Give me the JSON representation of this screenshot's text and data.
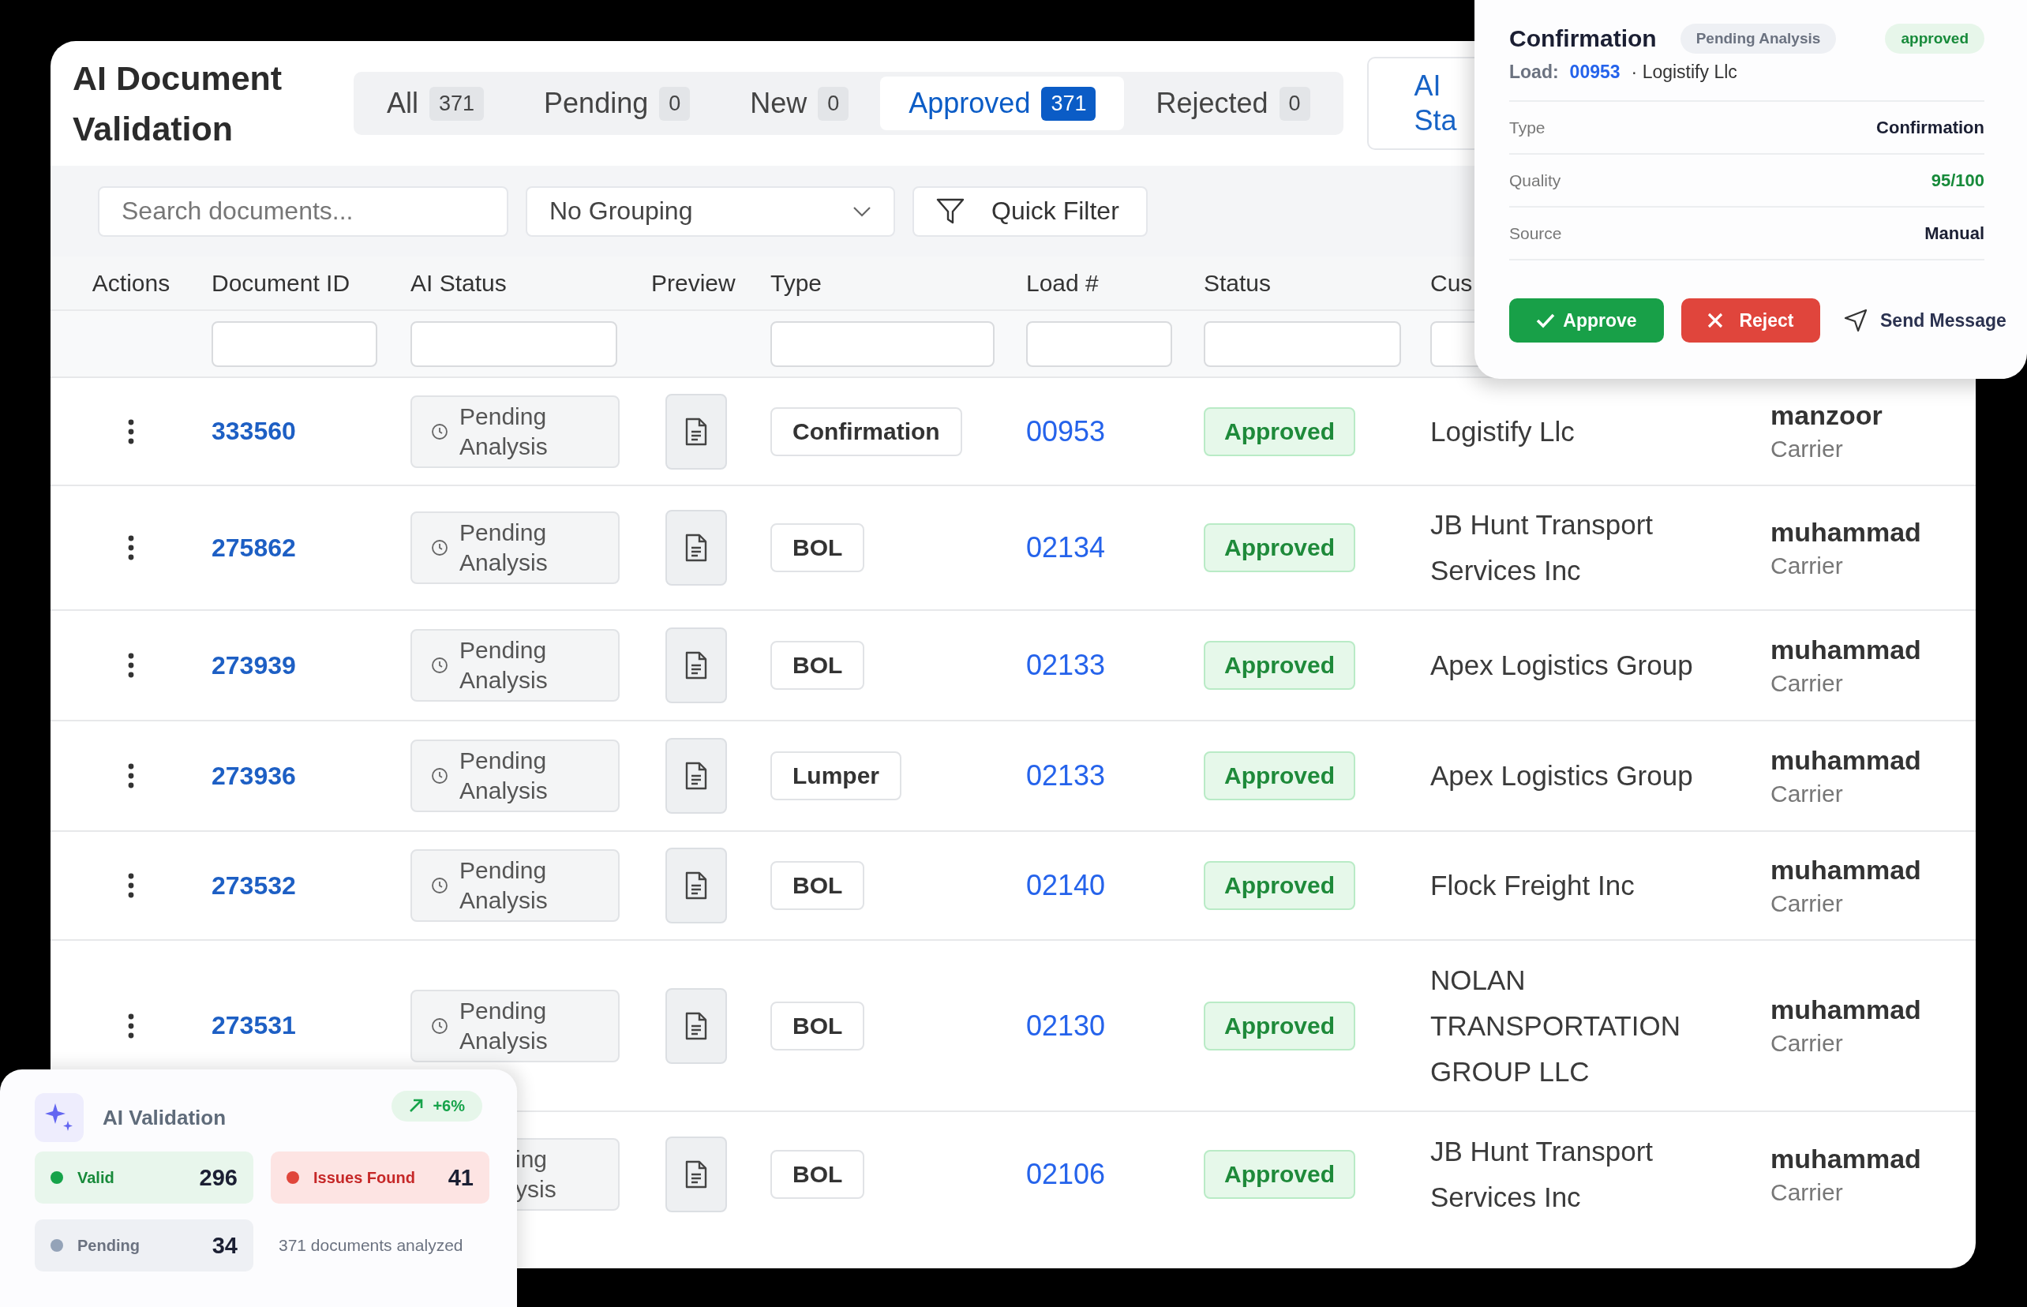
{
  "header": {
    "title": "AI Document Validation"
  },
  "tabs": [
    {
      "label": "All",
      "count": "371",
      "selected": false
    },
    {
      "label": "Pending",
      "count": "0",
      "selected": false
    },
    {
      "label": "New",
      "count": "0",
      "selected": false
    },
    {
      "label": "Approved",
      "count": "371",
      "selected": true
    },
    {
      "label": "Rejected",
      "count": "0",
      "selected": false
    }
  ],
  "side_button": {
    "label": "AI Sta"
  },
  "toolbar": {
    "search": {
      "placeholder": "Search documents..."
    },
    "grouping": {
      "value": "No Grouping"
    },
    "quick_filter": {
      "label": "Quick Filter"
    }
  },
  "table": {
    "columns": [
      {
        "label": "Actions",
        "filterable": false
      },
      {
        "label": "Document ID",
        "filterable": true
      },
      {
        "label": "AI Status",
        "filterable": true
      },
      {
        "label": "Preview",
        "filterable": false
      },
      {
        "label": "Type",
        "filterable": true
      },
      {
        "label": "Load #",
        "filterable": true
      },
      {
        "label": "Status",
        "filterable": true
      },
      {
        "label": "Cus",
        "filterable": true
      }
    ],
    "rows": [
      {
        "document_id": "333560",
        "ai_status": "Pending Analysis",
        "type": "Confirmation",
        "load": "00953",
        "status": "Approved",
        "customer": "Logistify Llc",
        "user": "manzoor",
        "role": "Carrier"
      },
      {
        "document_id": "275862",
        "ai_status": "Pending Analysis",
        "type": "BOL",
        "load": "02134",
        "status": "Approved",
        "customer": "JB Hunt Transport Services Inc",
        "user": "muhammad",
        "role": "Carrier"
      },
      {
        "document_id": "273939",
        "ai_status": "Pending Analysis",
        "type": "BOL",
        "load": "02133",
        "status": "Approved",
        "customer": "Apex Logistics Group",
        "user": "muhammad",
        "role": "Carrier"
      },
      {
        "document_id": "273936",
        "ai_status": "Pending Analysis",
        "type": "Lumper",
        "load": "02133",
        "status": "Approved",
        "customer": "Apex Logistics Group",
        "user": "muhammad",
        "role": "Carrier"
      },
      {
        "document_id": "273532",
        "ai_status": "Pending Analysis",
        "type": "BOL",
        "load": "02140",
        "status": "Approved",
        "customer": "Flock Freight Inc",
        "user": "muhammad",
        "role": "Carrier"
      },
      {
        "document_id": "273531",
        "ai_status": "Pending Analysis",
        "type": "BOL",
        "load": "02130",
        "status": "Approved",
        "customer": "NOLAN TRANSPORTATION GROUP LLC",
        "user": "muhammad",
        "role": "Carrier"
      },
      {
        "ai_status": "ing ysis",
        "ai_status_partial": true,
        "type": "BOL",
        "load": "02106",
        "status": "Approved",
        "customer": "JB Hunt Transport Services Inc",
        "user": "muhammad",
        "role": "Carrier"
      }
    ]
  },
  "detail_popup": {
    "title": "Confirmation",
    "badges": [
      {
        "label": "Pending Analysis",
        "kind": "neutral"
      },
      {
        "label": "approved",
        "kind": "success"
      }
    ],
    "load_label": "Load:",
    "load": "00953",
    "customer": "· Logistify Llc",
    "fields": [
      {
        "label": "Type",
        "value": "Confirmation",
        "kind": "plain"
      },
      {
        "label": "Quality",
        "value": "95/100",
        "kind": "good"
      },
      {
        "label": "Source",
        "value": "Manual",
        "kind": "plain"
      }
    ],
    "actions": [
      {
        "label": "Approve",
        "kind": "approve"
      },
      {
        "label": "Reject",
        "kind": "reject"
      },
      {
        "label": "Send Message",
        "kind": "link"
      }
    ]
  },
  "ai_validation_card": {
    "title": "AI Validation",
    "trend": "+6%",
    "stats": [
      {
        "label": "Valid",
        "value": "296",
        "kind": "valid",
        "color": "#16a34a"
      },
      {
        "label": "Issues Found",
        "value": "41",
        "kind": "issues",
        "color": "#e0463b"
      },
      {
        "label": "Pending",
        "value": "34",
        "kind": "pending",
        "color": "#94a3b8"
      }
    ],
    "summary": "371 documents analyzed"
  }
}
